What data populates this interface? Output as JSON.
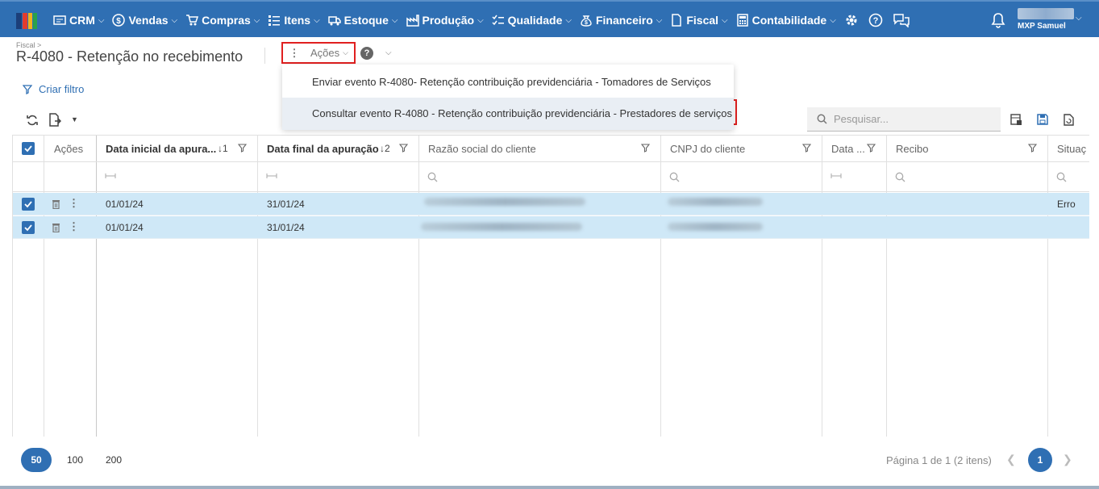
{
  "header": {
    "nav": [
      {
        "label": "CRM",
        "icon": "crm-icon"
      },
      {
        "label": "Vendas",
        "icon": "dollar-icon"
      },
      {
        "label": "Compras",
        "icon": "cart-icon"
      },
      {
        "label": "Itens",
        "icon": "list-icon"
      },
      {
        "label": "Estoque",
        "icon": "truck-icon"
      },
      {
        "label": "Produção",
        "icon": "factory-icon"
      },
      {
        "label": "Qualidade",
        "icon": "checklist-icon"
      },
      {
        "label": "Financeiro",
        "icon": "money-bag-icon"
      },
      {
        "label": "Fiscal",
        "icon": "document-icon"
      },
      {
        "label": "Contabilidade",
        "icon": "calculator-icon"
      }
    ],
    "user": {
      "name": "MXP Samuel"
    }
  },
  "page": {
    "breadcrumb": "Fiscal >",
    "title": "R-4080 - Retenção no recebimento",
    "actions_label": "Ações"
  },
  "actions_menu": {
    "items": [
      "Enviar evento R-4080- Retenção contribuição previdenciária - Tomadores de Serviços",
      "Consultar evento R-4080 - Retenção contribuição previdenciária - Prestadores de serviços"
    ]
  },
  "toolbar": {
    "create_filter": "Criar filtro",
    "search_placeholder": "Pesquisar..."
  },
  "grid": {
    "columns": [
      "Ações",
      "Data inicial da apura...",
      "Data final da apuração",
      "Razão social do cliente",
      "CNPJ do cliente",
      "Data ...",
      "Recibo",
      "Situaç"
    ],
    "sort": {
      "col1": "↓1",
      "col2": "↓2"
    },
    "rows": [
      {
        "data_inicial": "01/01/24",
        "data_final": "31/01/24",
        "situacao": "Erro"
      },
      {
        "data_inicial": "01/01/24",
        "data_final": "31/01/24",
        "situacao": ""
      }
    ]
  },
  "pager": {
    "sizes": [
      "50",
      "100",
      "200"
    ],
    "info": "Página 1 de 1 (2 itens)",
    "current": "1"
  },
  "colors": {
    "primary": "#2f6fb3",
    "highlight": "#e02020",
    "row_selected": "#cfe8f7"
  }
}
